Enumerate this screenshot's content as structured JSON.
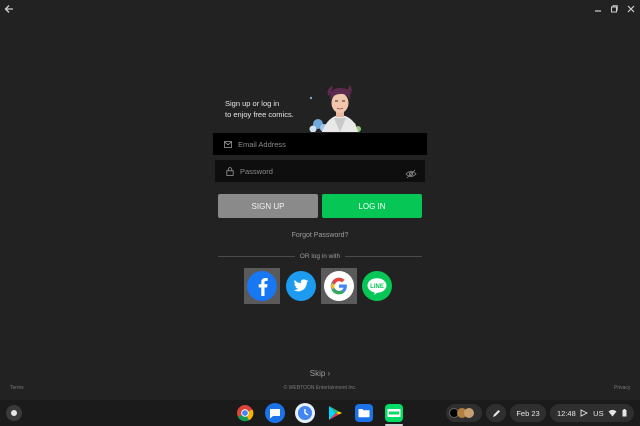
{
  "window": {
    "back_icon": "arrow-left-icon",
    "minimize_icon": "minimize-icon",
    "restore_icon": "restore-icon",
    "close_icon": "close-icon"
  },
  "promo": {
    "line1": "Sign up or log in",
    "line2": "to enjoy free comics."
  },
  "form": {
    "email_placeholder": "Email Address",
    "password_placeholder": "Password",
    "signup_label": "SIGN UP",
    "login_label": "LOG IN",
    "forgot_label": "Forgot Password?",
    "or_label": "OR log in with"
  },
  "social": [
    {
      "name": "facebook",
      "glyph": "f",
      "color": "#1877f2",
      "selected": true
    },
    {
      "name": "twitter",
      "glyph": "",
      "color": "#1d9bf0",
      "selected": false
    },
    {
      "name": "google",
      "glyph": "G",
      "color": "#ffffff",
      "selected": true
    },
    {
      "name": "line",
      "glyph": "LINE",
      "color": "#06c755",
      "selected": false
    }
  ],
  "skip_label": "Skip ›",
  "footer": {
    "left": "Terms",
    "center": "© WEBTOON Entertainment Inc.",
    "right": "Privacy"
  },
  "shelf": {
    "apps": [
      "chrome-icon",
      "messages-icon",
      "clock-icon",
      "play-store-icon",
      "files-icon",
      "webtoon-icon"
    ],
    "date": "Feb 23",
    "time": "12:48",
    "locale": "US"
  },
  "colors": {
    "background": "#222222",
    "login_green": "#06c755",
    "signup_gray": "#8a8a8a"
  }
}
